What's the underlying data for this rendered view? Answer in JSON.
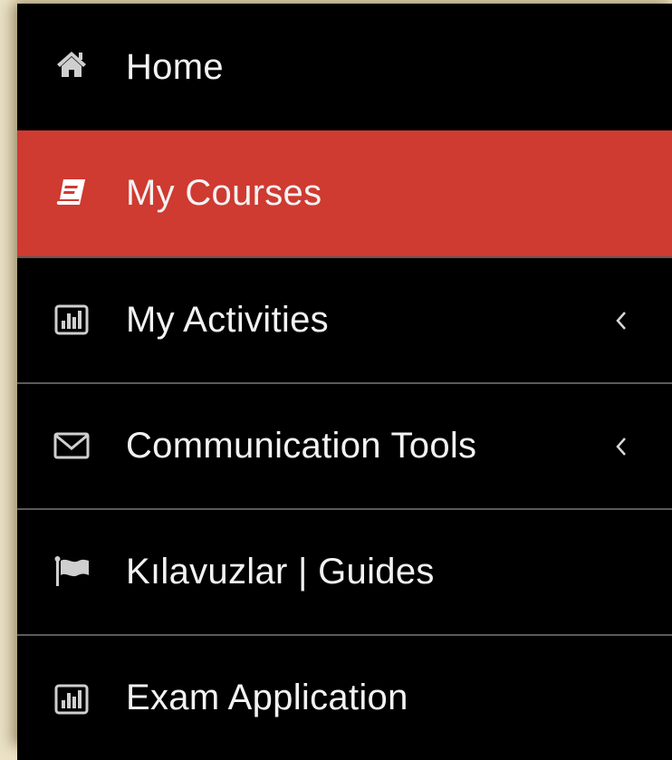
{
  "menu": {
    "items": [
      {
        "label": "Home",
        "icon": "home-icon",
        "active": false,
        "has_submenu": false
      },
      {
        "label": "My Courses",
        "icon": "book-icon",
        "active": true,
        "has_submenu": false
      },
      {
        "label": "My Activities",
        "icon": "bar-chart-icon",
        "active": false,
        "has_submenu": true
      },
      {
        "label": "Communication Tools",
        "icon": "envelope-icon",
        "active": false,
        "has_submenu": true
      },
      {
        "label": "Kılavuzlar | Guides",
        "icon": "flag-icon",
        "active": false,
        "has_submenu": false
      },
      {
        "label": "Exam Application",
        "icon": "bar-chart-icon",
        "active": false,
        "has_submenu": false
      }
    ]
  },
  "colors": {
    "background": "#000000",
    "active": "#cf3a31",
    "text": "#f2f2f2",
    "icon": "#cfcfcf",
    "divider": "#5a5a5a",
    "page": "#ece2c6"
  }
}
